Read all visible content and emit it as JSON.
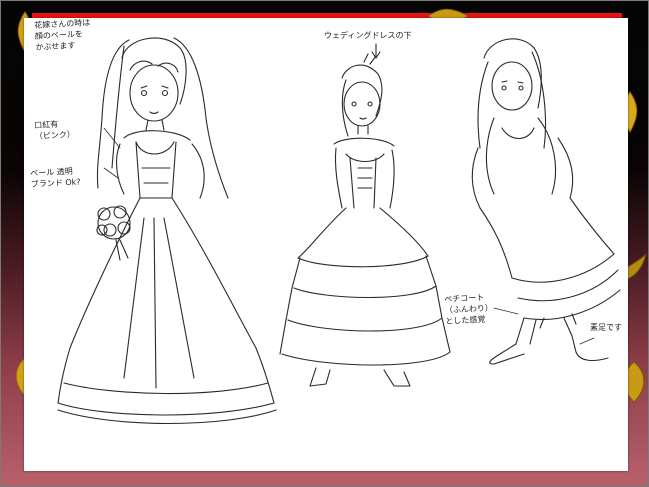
{
  "colors": {
    "background_top": "#050505",
    "background_bottom": "#b8616c",
    "accent_bar": "#e61414",
    "petal": "#d4a017",
    "sheet": "#ffffff",
    "ink": "#2a2a2a"
  },
  "annotations": {
    "top_left_line1": "花嫁さんの時は",
    "top_left_line2": "顔のベールを",
    "top_left_line3": "かぶせます",
    "makeup_line1": "口紅有",
    "makeup_line2": "（ピンク）",
    "veil_line1": "ベール 透明",
    "veil_line2": "ブランド Ok?",
    "top_center": "ウェディングドレスの下",
    "skirt_line1": "ペチコート",
    "skirt_line2": "（ふんわり）",
    "skirt_line3": "とした感覚",
    "bottom_right": "素足です"
  }
}
